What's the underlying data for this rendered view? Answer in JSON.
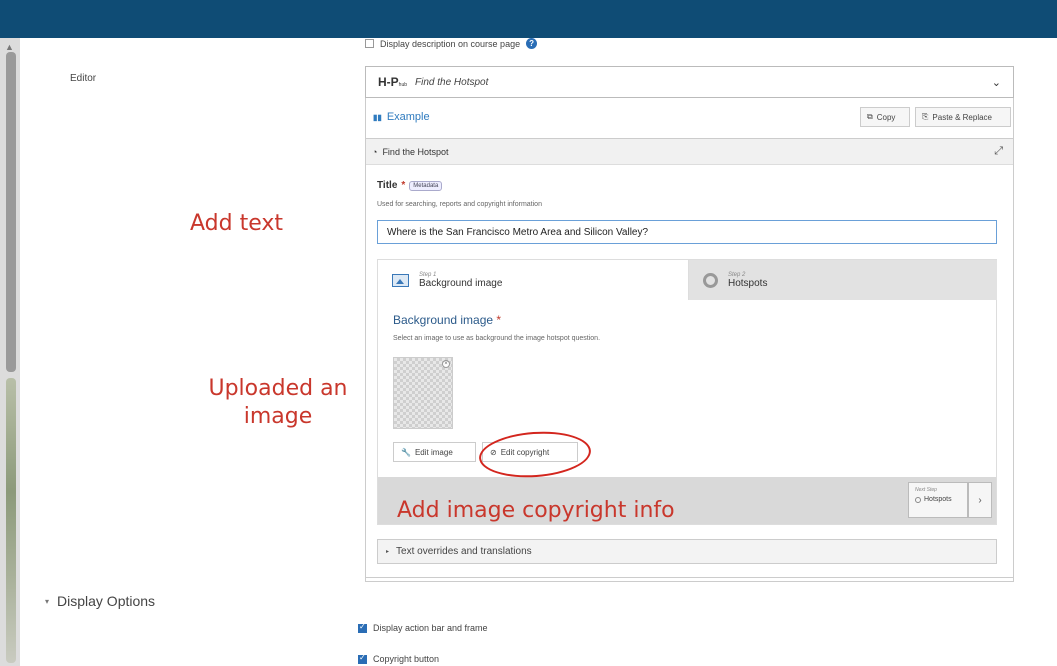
{
  "top_checkbox": {
    "label": "Display description on course page",
    "checked": false
  },
  "editor": {
    "label": "Editor"
  },
  "library": {
    "logo": "H-P",
    "name": "Find the Hotspot"
  },
  "example": {
    "label": "Example"
  },
  "toolbar": {
    "copy_label": "Copy",
    "paste_label": "Paste & Replace"
  },
  "panel": {
    "title": "Find the Hotspot"
  },
  "title_field": {
    "label": "Title",
    "required_mark": "*",
    "badge": "Metadata",
    "description": "Used for searching, reports and copyright information",
    "value": "Where is the San Francisco Metro Area and Silicon Valley?"
  },
  "steps": [
    {
      "small": "Step 1",
      "name": "Background image"
    },
    {
      "small": "Step 2",
      "name": "Hotspots"
    }
  ],
  "background": {
    "label": "Background image",
    "required_mark": "*",
    "description": "Select an image to use as background the image hotspot question.",
    "edit_image_label": "Edit image",
    "edit_copyright_label": "Edit copyright"
  },
  "next_step": {
    "small": "Next Step",
    "name": "Hotspots"
  },
  "overrides": {
    "label": "Text overrides and translations"
  },
  "display_options": {
    "label": "Display Options"
  },
  "options": [
    {
      "label": "Display action bar and frame",
      "checked": true
    },
    {
      "label": "Copyright button",
      "checked": true
    }
  ],
  "annotations": {
    "add_text": "Add text",
    "uploaded_line1": "Uploaded an",
    "uploaded_line2": "image",
    "copyright_info": "Add image copyright info",
    "color": "#c9372c"
  },
  "colors": {
    "topbar": "#0f4c75",
    "accent": "#2f7bbf"
  }
}
